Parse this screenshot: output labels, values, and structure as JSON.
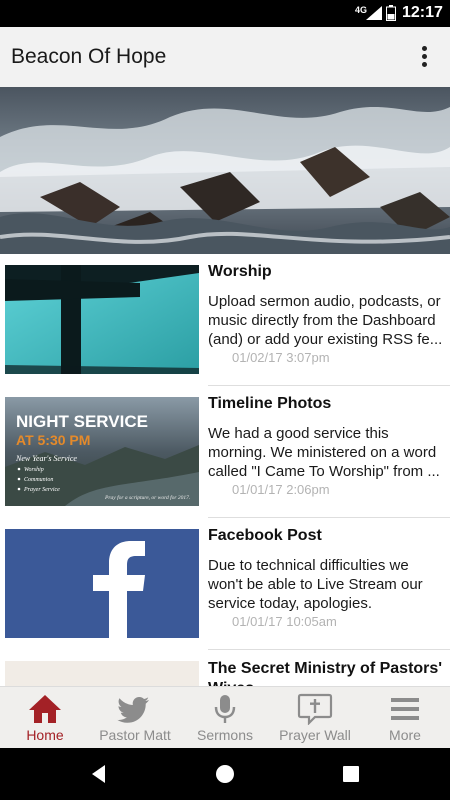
{
  "status_bar": {
    "network": "4G",
    "time": "12:17"
  },
  "app_bar": {
    "title": "Beacon Of Hope",
    "menu_icon": "overflow-menu-icon"
  },
  "hero": {
    "image": "stormy-sea-waves-image"
  },
  "feed": [
    {
      "title": "Worship",
      "body": "Upload sermon audio, podcasts, or music directly from the Dashboard (and) or add your existing RSS fe...",
      "date": "01/02/17 3:07pm",
      "thumb": "cross-silhouette-image"
    },
    {
      "title": "Timeline Photos",
      "body": "We had a good service this morning. We ministered on a word called \"I Came To Worship\" from ...",
      "date": "01/01/17 2:06pm",
      "thumb": "night-service-flyer-image",
      "flyer": {
        "heading": "NIGHT SERVICE",
        "time": "AT 5:30 PM",
        "subtitle": "New Year's Service",
        "items": [
          "Worship",
          "Communion",
          "Prayer Service"
        ],
        "note": "Pray for a scripture, or word for 2017."
      }
    },
    {
      "title": "Facebook Post",
      "body": "Due to technical difficulties we won't be able to Live Stream our service today, apologies.",
      "date": "01/01/17 10:05am",
      "thumb": "facebook-logo-image",
      "logo_letter": "f"
    },
    {
      "title": "The Secret Ministry of Pastors' Wives",
      "body": "",
      "date": "",
      "thumb": "book-cover-image"
    }
  ],
  "bottom_nav": [
    {
      "label": "Home",
      "icon": "home-icon",
      "active": true
    },
    {
      "label": "Pastor Matt",
      "icon": "twitter-bird-icon",
      "active": false
    },
    {
      "label": "Sermons",
      "icon": "microphone-icon",
      "active": false
    },
    {
      "label": "Prayer Wall",
      "icon": "prayer-cross-bubble-icon",
      "active": false
    },
    {
      "label": "More",
      "icon": "hamburger-menu-icon",
      "active": false
    }
  ],
  "system_nav": {
    "back": "back-icon",
    "home": "home-circle-icon",
    "recents": "recents-square-icon"
  },
  "colors": {
    "accent": "#a32126",
    "facebook": "#3b5998",
    "app_bar": "#f2f2f2",
    "nav_inactive": "#8c8c8c"
  }
}
